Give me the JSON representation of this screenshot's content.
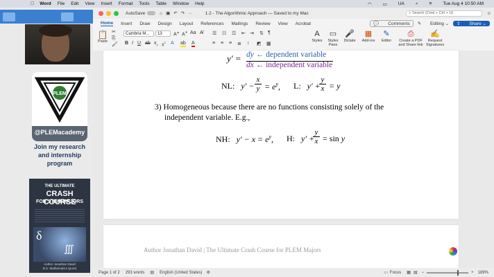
{
  "menubar": {
    "app": "Word",
    "items": [
      "File",
      "Edit",
      "View",
      "Insert",
      "Format",
      "Tools",
      "Table",
      "Window",
      "Help"
    ],
    "status_ua": "UA",
    "clock": "Tue Aug 4  10:50 AM"
  },
  "sidebar": {
    "handle": "@PLEMacademy",
    "tagline_1": "Join my research",
    "tagline_2": "and internship",
    "tagline_3": "program",
    "logo_text": "PLEM",
    "book": {
      "line1": "THE ULTIMATE",
      "line2": "CRASH COURSE",
      "line3": "FOR STEM MAJORS",
      "author": "Author Jonathan David",
      "degree": "B.S. Mathematics (pure)"
    }
  },
  "word": {
    "autosave_label": "AutoSave",
    "doc_title": "1.2 - The Algorithmic Approach — Saved to my Mac",
    "search_placeholder": "Search (Cmd + Ctrl + U)",
    "tabs": [
      "Home",
      "Insert",
      "Draw",
      "Design",
      "Layout",
      "References",
      "Mailings",
      "Review",
      "View",
      "Acrobat"
    ],
    "active_tab": "Home",
    "comments_label": "Comments",
    "editing_label": "Editing",
    "share_label": "Share",
    "ribbon": {
      "paste": "Paste",
      "font_name": "Cambria M...",
      "font_size": "13",
      "styles": "Styles",
      "styles_pane": "Styles Pane",
      "dictate": "Dictate",
      "addins": "Add-ins",
      "editor": "Editor",
      "create_pdf": "Create a PDF and Share link",
      "request_sig": "Request Signatures"
    },
    "doc": {
      "arrow_dep": "← dependent variable",
      "arrow_indep": "← independent variable",
      "nl_label": "NL:",
      "l_label": "L:",
      "item3_line1": "3)  Homogeneous because there are no functions consisting solely of the",
      "item3_line2": "independent variable. E.g.,",
      "nh_label": "NH:",
      "h_label": "H:",
      "footer": "Author Jonathan David | The Ultimate Crash Course for PLEM Majors",
      "colors": {
        "dep": "#2a5db0",
        "indep": "#7b2a8e"
      }
    },
    "status": {
      "page": "Page 1 of 2",
      "words": "293 words",
      "language": "English (United States)",
      "focus": "Focus",
      "zoom": "189%"
    }
  }
}
